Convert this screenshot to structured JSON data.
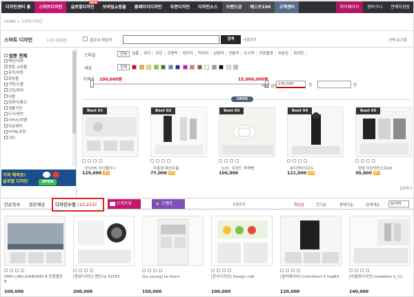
{
  "nav": {
    "items": [
      {
        "label": "디자인센터 홈",
        "style": ""
      },
      {
        "label": "스마트디자인",
        "style": "active"
      },
      {
        "label": "글로벌디자인",
        "style": "",
        "badge": "NEW"
      },
      {
        "label": "모바일쇼핑몰",
        "style": ""
      },
      {
        "label": "홈페이지디자인",
        "style": ""
      },
      {
        "label": "부분디자인",
        "style": ""
      },
      {
        "label": "디자인소스",
        "style": ""
      },
      {
        "label": "브랜드샵",
        "style": "light"
      },
      {
        "label": "베스트100",
        "style": "light"
      },
      {
        "label": "고객센터",
        "style": "selected"
      }
    ],
    "right": [
      "마이페이지",
      "장바구니",
      "판매자광장"
    ]
  },
  "breadcrumb": "HOME > 스마트디자인",
  "search": {
    "title": "스마트 디자인",
    "subtitle": "(구) 디자인",
    "within_label": "결과내 재검색",
    "button": "검색",
    "advanced": "상품검색",
    "close": "선택 초기화"
  },
  "sidebar": {
    "header": "업종 전체",
    "items": [
      "패션/의류",
      "종합 쇼핑몰",
      "유아/아동",
      "화장품",
      "가방/소품",
      "건강/취미",
      "식품",
      "컴퓨터/통신",
      "생활가전",
      "도서/음반",
      "서비스/여행",
      "주문제작",
      "HTML포장",
      "기타"
    ]
  },
  "banner": {
    "line1": "가져 해외로!",
    "line2": "글로벌 디자인",
    "open": "OPEN"
  },
  "filters": {
    "style_label": "스타일",
    "styles": [
      "전체",
      "심플",
      "큐티",
      "모던",
      "로맨틱",
      "빈티지",
      "럭셔리",
      "심쌍적",
      "전통적",
      "도시적",
      "자연물경",
      "차분한",
      "화려한"
    ],
    "color_label": "색상",
    "color_all": "전체",
    "colors": [
      "#d0021b",
      "#f5a623",
      "#f8e71c",
      "#7ed321",
      "#417505",
      "#4a90e2",
      "#1d2a8c",
      "#bd10e0",
      "#f06292",
      "#8b572a",
      "#ffffff",
      "#9b9b9b",
      "#000000",
      "#e0e0e0",
      "#c0c0c0"
    ],
    "price_label": "가격대",
    "price_min": "100,000원",
    "price_max": "15,000,000원",
    "direct_label": "직접 입력",
    "direct_min": "100,000",
    "won": "원"
  },
  "open_button": "OPEN",
  "best": [
    {
      "tag": "Best 01",
      "name": "모던H5 아이웹이니",
      "price": "129,000",
      "badge": "인기"
    },
    {
      "tag": "Best 02",
      "name": "마들렌 패션우륨",
      "price": "77,000",
      "badge": "인기"
    },
    {
      "tag": "Best 03",
      "name": "S29_ 트렌드 쿡쿡빵",
      "price": "100,000",
      "badge": ""
    },
    {
      "tag": "Best 04",
      "name": "뷰티앤라이프S",
      "price": "121,000",
      "badge": "인기"
    },
    {
      "tag": "Best 05",
      "name": "장밤 모던엔진스토KR",
      "price": "30,000",
      "badge": "인기"
    }
  ],
  "share_label": "공유하기",
  "tabs": {
    "simple": "단순복사",
    "origin": "원본제공",
    "design_edit": "디자인수정",
    "design_count": "(10,223)",
    "stock": "스마트뷰",
    "stamp": "스탬프",
    "info": "상품검색"
  },
  "sort": {
    "options": [
      "최신순",
      "인기순",
      "판매가순",
      "금액대순"
    ],
    "selected": "최신순",
    "perpage": "60개씩"
  },
  "grid": [
    {
      "name": "DMO LAB] GIARDINO 8 트렌젤의 8",
      "price": "100,000"
    },
    {
      "name": "[몽뮤디자인] 몽탄no 31553",
      "price": "200,000"
    },
    {
      "name": "[by young] Le blanc",
      "price": "150,000"
    },
    {
      "name": "[한국디자인] Design no6",
      "price": "100,000"
    },
    {
      "name": "[컬러레이어] Colorfelevi S hop83",
      "price": "120,000"
    },
    {
      "name": "[마들렌디자인] madelem e_11",
      "price": "140,000"
    }
  ]
}
